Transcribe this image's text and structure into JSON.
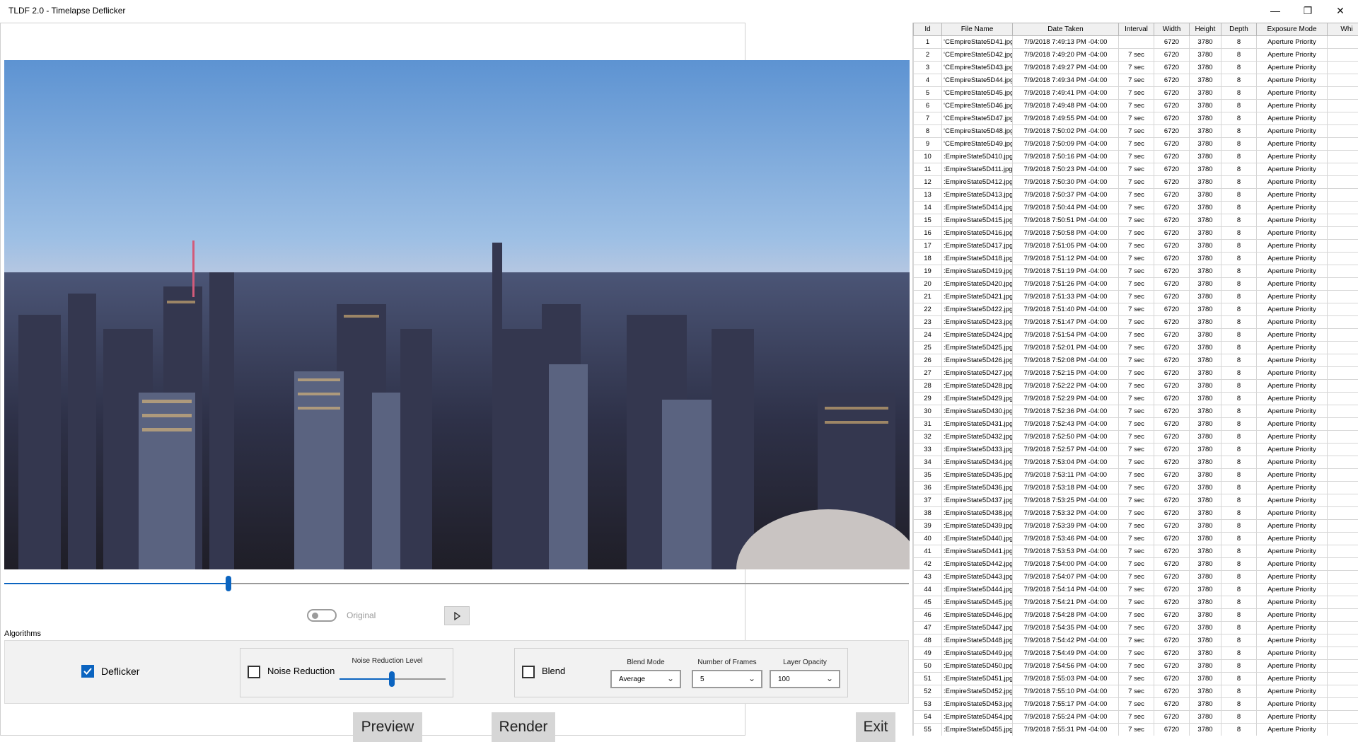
{
  "window": {
    "title": "TLDF 2.0 - Timelapse Deflicker"
  },
  "colors": {
    "accent": "#0b64c0"
  },
  "preview": {
    "slider_fraction": 0.245
  },
  "toggle": {
    "label": "Original",
    "on": false
  },
  "algorithms": {
    "label": "Algorithms",
    "deflicker": {
      "label": "Deflicker",
      "checked": true
    },
    "noise_reduction": {
      "label": "Noise Reduction",
      "checked": false,
      "level_label": "Noise Reduction Level",
      "level_fraction": 0.5
    },
    "blend": {
      "label": "Blend",
      "checked": false,
      "mode_label": "Blend Mode",
      "mode_value": "Average",
      "frames_label": "Number of Frames",
      "frames_value": "5",
      "opacity_label": "Layer Opacity",
      "opacity_value": "100"
    }
  },
  "buttons": {
    "preview": "Preview",
    "render": "Render",
    "exit": "Exit"
  },
  "table": {
    "columns": [
      "Id",
      "File Name",
      "Date Taken",
      "Interval",
      "Width",
      "Height",
      "Depth",
      "Exposure Mode",
      "Whi"
    ],
    "rows": [
      [
        "1",
        "ʻCEmpireState5D41.jpg",
        "7/9/2018 7:49:13 PM -04:00",
        "",
        "6720",
        "3780",
        "8",
        "Aperture Priority"
      ],
      [
        "2",
        "ʻCEmpireState5D42.jpg",
        "7/9/2018 7:49:20 PM -04:00",
        "7 sec",
        "6720",
        "3780",
        "8",
        "Aperture Priority"
      ],
      [
        "3",
        "ʻCEmpireState5D43.jpg",
        "7/9/2018 7:49:27 PM -04:00",
        "7 sec",
        "6720",
        "3780",
        "8",
        "Aperture Priority"
      ],
      [
        "4",
        "ʻCEmpireState5D44.jpg",
        "7/9/2018 7:49:34 PM -04:00",
        "7 sec",
        "6720",
        "3780",
        "8",
        "Aperture Priority"
      ],
      [
        "5",
        "ʻCEmpireState5D45.jpg",
        "7/9/2018 7:49:41 PM -04:00",
        "7 sec",
        "6720",
        "3780",
        "8",
        "Aperture Priority"
      ],
      [
        "6",
        "ʻCEmpireState5D46.jpg",
        "7/9/2018 7:49:48 PM -04:00",
        "7 sec",
        "6720",
        "3780",
        "8",
        "Aperture Priority"
      ],
      [
        "7",
        "ʻCEmpireState5D47.jpg",
        "7/9/2018 7:49:55 PM -04:00",
        "7 sec",
        "6720",
        "3780",
        "8",
        "Aperture Priority"
      ],
      [
        "8",
        "ʻCEmpireState5D48.jpg",
        "7/9/2018 7:50:02 PM -04:00",
        "7 sec",
        "6720",
        "3780",
        "8",
        "Aperture Priority"
      ],
      [
        "9",
        "ʻCEmpireState5D49.jpg",
        "7/9/2018 7:50:09 PM -04:00",
        "7 sec",
        "6720",
        "3780",
        "8",
        "Aperture Priority"
      ],
      [
        "10",
        ":EmpireState5D410.jpg",
        "7/9/2018 7:50:16 PM -04:00",
        "7 sec",
        "6720",
        "3780",
        "8",
        "Aperture Priority"
      ],
      [
        "11",
        ":EmpireState5D411.jpg",
        "7/9/2018 7:50:23 PM -04:00",
        "7 sec",
        "6720",
        "3780",
        "8",
        "Aperture Priority"
      ],
      [
        "12",
        ":EmpireState5D412.jpg",
        "7/9/2018 7:50:30 PM -04:00",
        "7 sec",
        "6720",
        "3780",
        "8",
        "Aperture Priority"
      ],
      [
        "13",
        ":EmpireState5D413.jpg",
        "7/9/2018 7:50:37 PM -04:00",
        "7 sec",
        "6720",
        "3780",
        "8",
        "Aperture Priority"
      ],
      [
        "14",
        ":EmpireState5D414.jpg",
        "7/9/2018 7:50:44 PM -04:00",
        "7 sec",
        "6720",
        "3780",
        "8",
        "Aperture Priority"
      ],
      [
        "15",
        ":EmpireState5D415.jpg",
        "7/9/2018 7:50:51 PM -04:00",
        "7 sec",
        "6720",
        "3780",
        "8",
        "Aperture Priority"
      ],
      [
        "16",
        ":EmpireState5D416.jpg",
        "7/9/2018 7:50:58 PM -04:00",
        "7 sec",
        "6720",
        "3780",
        "8",
        "Aperture Priority"
      ],
      [
        "17",
        ":EmpireState5D417.jpg",
        "7/9/2018 7:51:05 PM -04:00",
        "7 sec",
        "6720",
        "3780",
        "8",
        "Aperture Priority"
      ],
      [
        "18",
        ":EmpireState5D418.jpg",
        "7/9/2018 7:51:12 PM -04:00",
        "7 sec",
        "6720",
        "3780",
        "8",
        "Aperture Priority"
      ],
      [
        "19",
        ":EmpireState5D419.jpg",
        "7/9/2018 7:51:19 PM -04:00",
        "7 sec",
        "6720",
        "3780",
        "8",
        "Aperture Priority"
      ],
      [
        "20",
        ":EmpireState5D420.jpg",
        "7/9/2018 7:51:26 PM -04:00",
        "7 sec",
        "6720",
        "3780",
        "8",
        "Aperture Priority"
      ],
      [
        "21",
        ":EmpireState5D421.jpg",
        "7/9/2018 7:51:33 PM -04:00",
        "7 sec",
        "6720",
        "3780",
        "8",
        "Aperture Priority"
      ],
      [
        "22",
        ":EmpireState5D422.jpg",
        "7/9/2018 7:51:40 PM -04:00",
        "7 sec",
        "6720",
        "3780",
        "8",
        "Aperture Priority"
      ],
      [
        "23",
        ":EmpireState5D423.jpg",
        "7/9/2018 7:51:47 PM -04:00",
        "7 sec",
        "6720",
        "3780",
        "8",
        "Aperture Priority"
      ],
      [
        "24",
        ":EmpireState5D424.jpg",
        "7/9/2018 7:51:54 PM -04:00",
        "7 sec",
        "6720",
        "3780",
        "8",
        "Aperture Priority"
      ],
      [
        "25",
        ":EmpireState5D425.jpg",
        "7/9/2018 7:52:01 PM -04:00",
        "7 sec",
        "6720",
        "3780",
        "8",
        "Aperture Priority"
      ],
      [
        "26",
        ":EmpireState5D426.jpg",
        "7/9/2018 7:52:08 PM -04:00",
        "7 sec",
        "6720",
        "3780",
        "8",
        "Aperture Priority"
      ],
      [
        "27",
        ":EmpireState5D427.jpg",
        "7/9/2018 7:52:15 PM -04:00",
        "7 sec",
        "6720",
        "3780",
        "8",
        "Aperture Priority"
      ],
      [
        "28",
        ":EmpireState5D428.jpg",
        "7/9/2018 7:52:22 PM -04:00",
        "7 sec",
        "6720",
        "3780",
        "8",
        "Aperture Priority"
      ],
      [
        "29",
        ":EmpireState5D429.jpg",
        "7/9/2018 7:52:29 PM -04:00",
        "7 sec",
        "6720",
        "3780",
        "8",
        "Aperture Priority"
      ],
      [
        "30",
        ":EmpireState5D430.jpg",
        "7/9/2018 7:52:36 PM -04:00",
        "7 sec",
        "6720",
        "3780",
        "8",
        "Aperture Priority"
      ],
      [
        "31",
        ":EmpireState5D431.jpg",
        "7/9/2018 7:52:43 PM -04:00",
        "7 sec",
        "6720",
        "3780",
        "8",
        "Aperture Priority"
      ],
      [
        "32",
        ":EmpireState5D432.jpg",
        "7/9/2018 7:52:50 PM -04:00",
        "7 sec",
        "6720",
        "3780",
        "8",
        "Aperture Priority"
      ],
      [
        "33",
        ":EmpireState5D433.jpg",
        "7/9/2018 7:52:57 PM -04:00",
        "7 sec",
        "6720",
        "3780",
        "8",
        "Aperture Priority"
      ],
      [
        "34",
        ":EmpireState5D434.jpg",
        "7/9/2018 7:53:04 PM -04:00",
        "7 sec",
        "6720",
        "3780",
        "8",
        "Aperture Priority"
      ],
      [
        "35",
        ":EmpireState5D435.jpg",
        "7/9/2018 7:53:11 PM -04:00",
        "7 sec",
        "6720",
        "3780",
        "8",
        "Aperture Priority"
      ],
      [
        "36",
        ":EmpireState5D436.jpg",
        "7/9/2018 7:53:18 PM -04:00",
        "7 sec",
        "6720",
        "3780",
        "8",
        "Aperture Priority"
      ],
      [
        "37",
        ":EmpireState5D437.jpg",
        "7/9/2018 7:53:25 PM -04:00",
        "7 sec",
        "6720",
        "3780",
        "8",
        "Aperture Priority"
      ],
      [
        "38",
        ":EmpireState5D438.jpg",
        "7/9/2018 7:53:32 PM -04:00",
        "7 sec",
        "6720",
        "3780",
        "8",
        "Aperture Priority"
      ],
      [
        "39",
        ":EmpireState5D439.jpg",
        "7/9/2018 7:53:39 PM -04:00",
        "7 sec",
        "6720",
        "3780",
        "8",
        "Aperture Priority"
      ],
      [
        "40",
        ":EmpireState5D440.jpg",
        "7/9/2018 7:53:46 PM -04:00",
        "7 sec",
        "6720",
        "3780",
        "8",
        "Aperture Priority"
      ],
      [
        "41",
        ":EmpireState5D441.jpg",
        "7/9/2018 7:53:53 PM -04:00",
        "7 sec",
        "6720",
        "3780",
        "8",
        "Aperture Priority"
      ],
      [
        "42",
        ":EmpireState5D442.jpg",
        "7/9/2018 7:54:00 PM -04:00",
        "7 sec",
        "6720",
        "3780",
        "8",
        "Aperture Priority"
      ],
      [
        "43",
        ":EmpireState5D443.jpg",
        "7/9/2018 7:54:07 PM -04:00",
        "7 sec",
        "6720",
        "3780",
        "8",
        "Aperture Priority"
      ],
      [
        "44",
        ":EmpireState5D444.jpg",
        "7/9/2018 7:54:14 PM -04:00",
        "7 sec",
        "6720",
        "3780",
        "8",
        "Aperture Priority"
      ],
      [
        "45",
        ":EmpireState5D445.jpg",
        "7/9/2018 7:54:21 PM -04:00",
        "7 sec",
        "6720",
        "3780",
        "8",
        "Aperture Priority"
      ],
      [
        "46",
        ":EmpireState5D446.jpg",
        "7/9/2018 7:54:28 PM -04:00",
        "7 sec",
        "6720",
        "3780",
        "8",
        "Aperture Priority"
      ],
      [
        "47",
        ":EmpireState5D447.jpg",
        "7/9/2018 7:54:35 PM -04:00",
        "7 sec",
        "6720",
        "3780",
        "8",
        "Aperture Priority"
      ],
      [
        "48",
        ":EmpireState5D448.jpg",
        "7/9/2018 7:54:42 PM -04:00",
        "7 sec",
        "6720",
        "3780",
        "8",
        "Aperture Priority"
      ],
      [
        "49",
        ":EmpireState5D449.jpg",
        "7/9/2018 7:54:49 PM -04:00",
        "7 sec",
        "6720",
        "3780",
        "8",
        "Aperture Priority"
      ],
      [
        "50",
        ":EmpireState5D450.jpg",
        "7/9/2018 7:54:56 PM -04:00",
        "7 sec",
        "6720",
        "3780",
        "8",
        "Aperture Priority"
      ],
      [
        "51",
        ":EmpireState5D451.jpg",
        "7/9/2018 7:55:03 PM -04:00",
        "7 sec",
        "6720",
        "3780",
        "8",
        "Aperture Priority"
      ],
      [
        "52",
        ":EmpireState5D452.jpg",
        "7/9/2018 7:55:10 PM -04:00",
        "7 sec",
        "6720",
        "3780",
        "8",
        "Aperture Priority"
      ],
      [
        "53",
        ":EmpireState5D453.jpg",
        "7/9/2018 7:55:17 PM -04:00",
        "7 sec",
        "6720",
        "3780",
        "8",
        "Aperture Priority"
      ],
      [
        "54",
        ":EmpireState5D454.jpg",
        "7/9/2018 7:55:24 PM -04:00",
        "7 sec",
        "6720",
        "3780",
        "8",
        "Aperture Priority"
      ],
      [
        "55",
        ":EmpireState5D455.jpg",
        "7/9/2018 7:55:31 PM -04:00",
        "7 sec",
        "6720",
        "3780",
        "8",
        "Aperture Priority"
      ]
    ]
  }
}
